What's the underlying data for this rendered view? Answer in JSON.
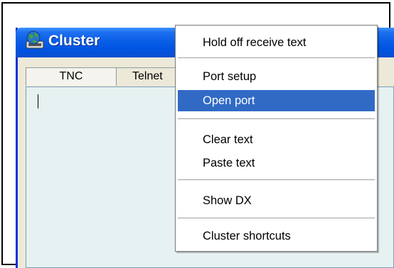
{
  "window": {
    "title": "Cluster",
    "tabs": [
      {
        "label": "TNC"
      },
      {
        "label": "Telnet"
      }
    ]
  },
  "context_menu": {
    "items": [
      {
        "label": "Hold off receive text",
        "highlighted": false
      },
      {
        "label": "Port setup",
        "highlighted": false
      },
      {
        "label": "Open port",
        "highlighted": true
      },
      {
        "label": "Clear text",
        "highlighted": false
      },
      {
        "label": "Paste text",
        "highlighted": false
      },
      {
        "label": "Show DX",
        "highlighted": false
      },
      {
        "label": "Cluster shortcuts",
        "highlighted": false
      }
    ]
  },
  "colors": {
    "titlebar": "#0054e3",
    "menu_highlight": "#316ac5",
    "text_area": "#e6f1f1"
  }
}
